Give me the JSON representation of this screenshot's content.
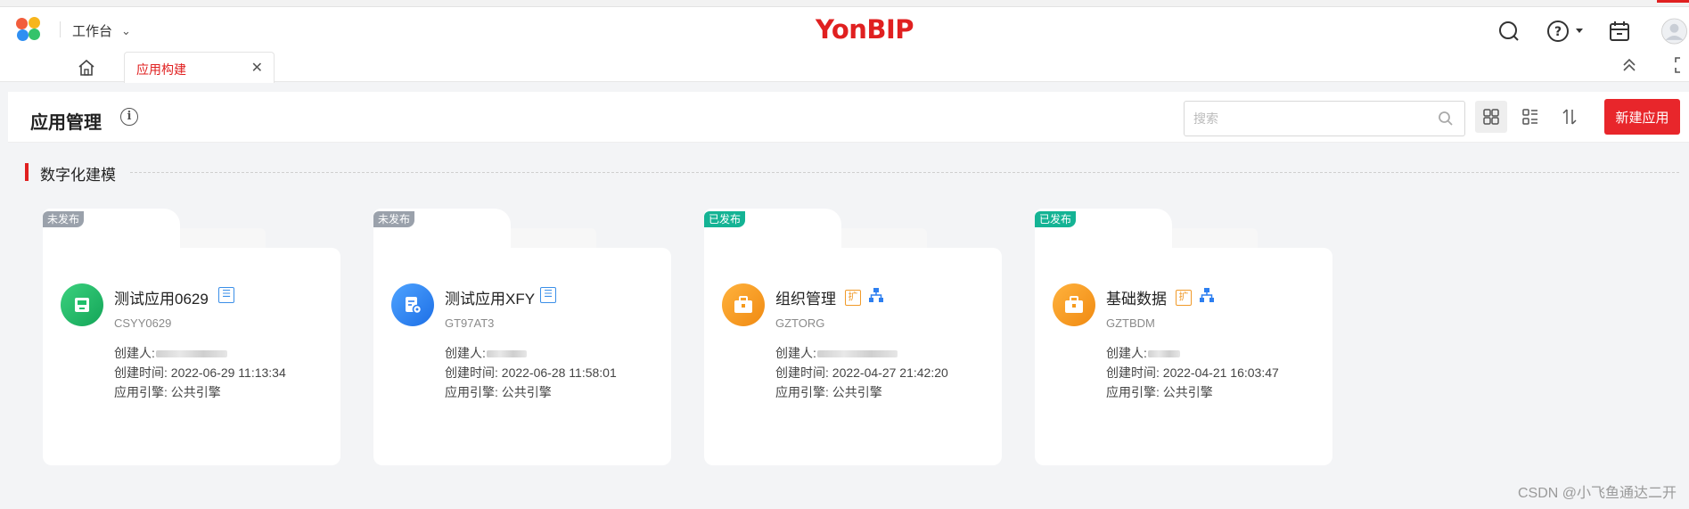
{
  "topbar": {
    "workspace_label": "工作台",
    "brand": "YonBIP",
    "icons": [
      "logo-icon",
      "search-icon",
      "help-icon",
      "calendar-icon",
      "avatar"
    ]
  },
  "tabs": {
    "active_label": "应用构建"
  },
  "header": {
    "title": "应用管理",
    "search_placeholder": "搜索",
    "new_button": "新建应用"
  },
  "section": {
    "title": "数字化建模"
  },
  "cards": [
    {
      "status": "未发布",
      "status_color": "#9aa1ab",
      "name": "测试应用0629",
      "code": "CSYY0629",
      "creator_label": "创建人:",
      "created_time": "创建时间: 2022-06-29 11:13:34",
      "engine": "应用引擎: 公共引擎",
      "icon_color": "#1fbf6a"
    },
    {
      "status": "未发布",
      "status_color": "#9aa1ab",
      "name": "测试应用XFY",
      "code": "GT97AT3",
      "creator_label": "创建人:",
      "created_time": "创建时间: 2022-06-28 11:58:01",
      "engine": "应用引擎: 公共引擎",
      "icon_color": "#2d7ff0"
    },
    {
      "status": "已发布",
      "status_color": "#14b394",
      "name": "组织管理",
      "code": "GZTORG",
      "ext_label": "扩",
      "creator_label": "创建人:",
      "created_time": "创建时间: 2022-04-27 21:42:20",
      "engine": "应用引擎: 公共引擎",
      "icon_color": "#f59a1c"
    },
    {
      "status": "已发布",
      "status_color": "#14b394",
      "name": "基础数据",
      "code": "GZTBDM",
      "ext_label": "扩",
      "creator_label": "创建人:",
      "created_time": "创建时间: 2022-04-21 16:03:47",
      "engine": "应用引擎: 公共引擎",
      "icon_color": "#f59a1c"
    }
  ],
  "watermark": "CSDN @小飞鱼通达二开"
}
